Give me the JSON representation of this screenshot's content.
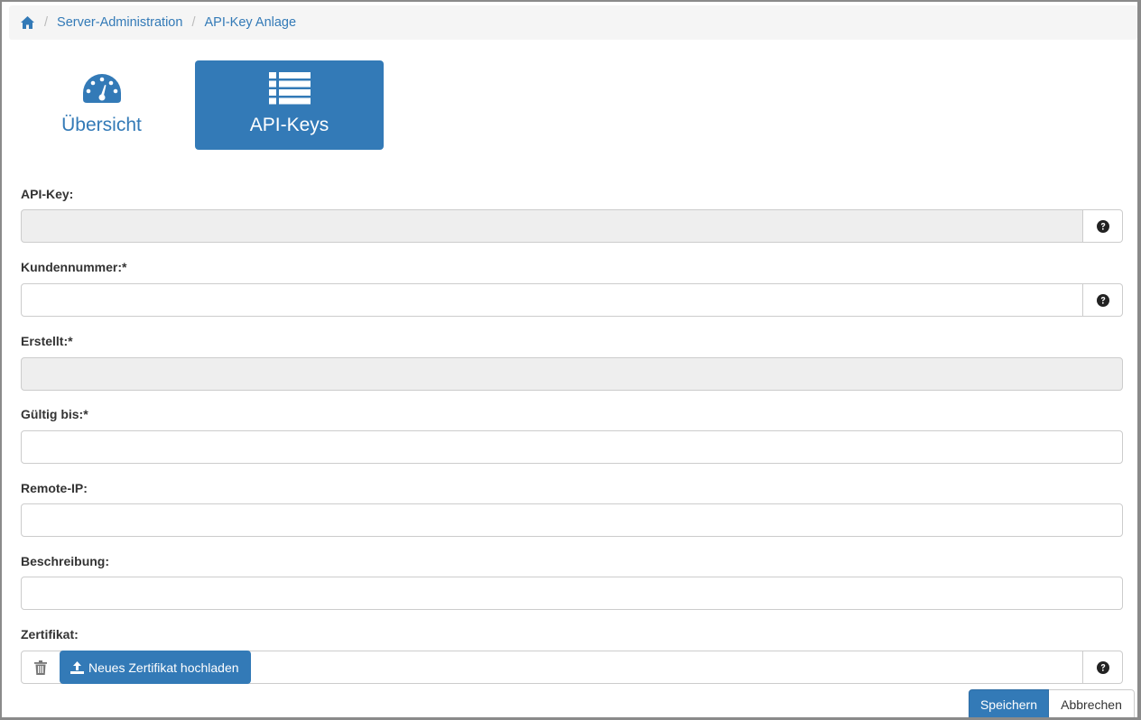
{
  "breadcrumb": {
    "home_icon": "home-icon",
    "items": [
      "Server-Administration",
      "API-Key Anlage"
    ]
  },
  "tiles": {
    "overview": {
      "label": "Übersicht",
      "icon": "dashboard-gauge-icon"
    },
    "apikeys": {
      "label": "API-Keys",
      "icon": "list-icon",
      "active": true
    }
  },
  "form": {
    "api_key": {
      "label": "API-Key:",
      "value": "",
      "help_icon": "question-circle-icon"
    },
    "customer_number": {
      "label": "Kundennummer:*",
      "value": "",
      "help_icon": "question-circle-icon"
    },
    "created": {
      "label": "Erstellt:*",
      "value": ""
    },
    "valid_until": {
      "label": "Gültig bis:*",
      "value": ""
    },
    "remote_ip": {
      "label": "Remote-IP:",
      "value": ""
    },
    "description": {
      "label": "Beschreibung:",
      "value": ""
    },
    "certificate": {
      "label": "Zertifikat:",
      "delete_icon": "trash-icon",
      "upload_label": "Neues Zertifikat hochladen",
      "upload_icon": "upload-icon",
      "help_icon": "question-circle-icon"
    }
  },
  "actions": {
    "save": "Speichern",
    "cancel": "Abbrechen"
  },
  "colors": {
    "primary": "#337ab7",
    "readonly_bg": "#eeeeee",
    "border": "#cccccc",
    "breadcrumb_bg": "#f5f5f5"
  }
}
